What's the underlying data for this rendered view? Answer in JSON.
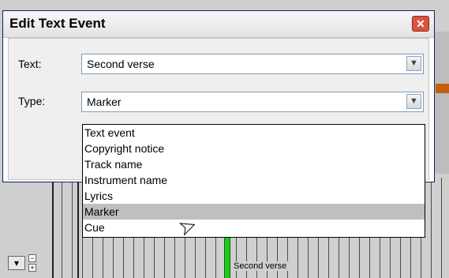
{
  "dialog": {
    "title": "Edit Text Event",
    "close_glyph": "✕",
    "text_label": "Text:",
    "text_value": "Second verse",
    "type_label": "Type:",
    "type_value": "Marker",
    "dropdown_arrow": "▼"
  },
  "dropdown_items": [
    {
      "label": "Text event",
      "selected": false
    },
    {
      "label": "Copyright notice",
      "selected": false
    },
    {
      "label": "Track name",
      "selected": false
    },
    {
      "label": "Instrument name",
      "selected": false
    },
    {
      "label": "Lyrics",
      "selected": false
    },
    {
      "label": "Marker",
      "selected": true
    },
    {
      "label": "Cue",
      "selected": false
    }
  ],
  "background": {
    "track_text": "Second verse",
    "collapse_glyph": "▾",
    "minus": "−",
    "plus": "+"
  },
  "colors": {
    "close_button": "#d9533f",
    "marker": "#1ec81e",
    "selected_item": "#bfbfbf"
  },
  "icons": [
    "close-icon",
    "chevron-down-icon",
    "mouse-cursor-icon"
  ]
}
